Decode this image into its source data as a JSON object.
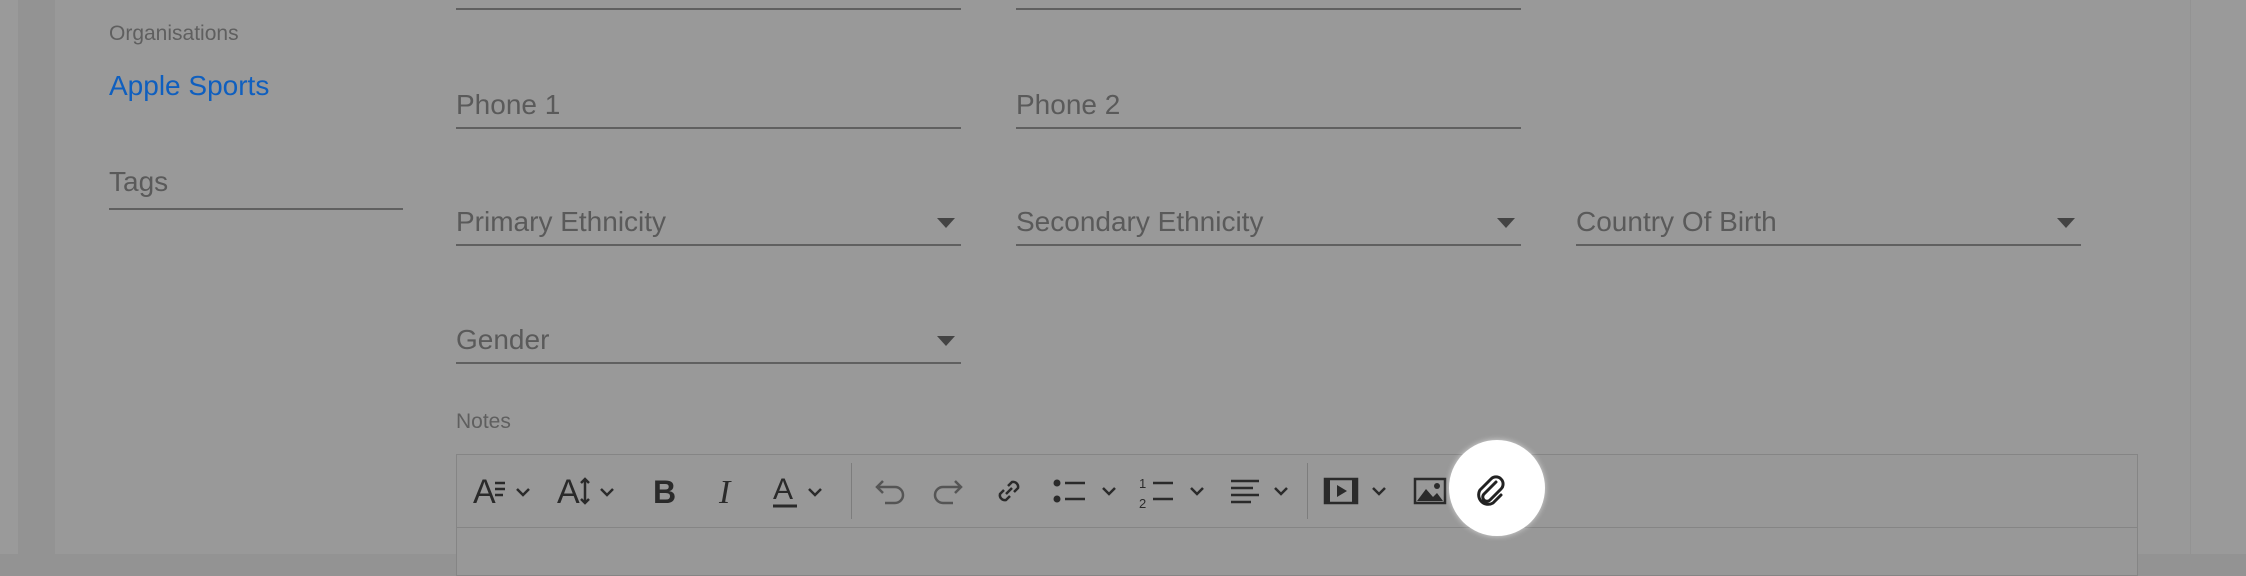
{
  "sidebar": {
    "organisations_label": "Organisations",
    "organisation": "Apple Sports",
    "tags_label": "Tags"
  },
  "form": {
    "phone1_label": "Phone 1",
    "phone2_label": "Phone 2",
    "primary_ethnicity_label": "Primary Ethnicity",
    "secondary_ethnicity_label": "Secondary Ethnicity",
    "country_of_birth_label": "Country Of Birth",
    "gender_label": "Gender",
    "notes_label": "Notes"
  },
  "toolbar": {
    "icons": [
      "paragraph-format-icon",
      "font-size-icon",
      "bold-icon",
      "italic-icon",
      "text-color-icon",
      "undo-icon",
      "redo-icon",
      "link-icon",
      "bullet-list-icon",
      "numbered-list-icon",
      "align-icon",
      "video-icon",
      "image-icon",
      "attachment-icon"
    ],
    "highlighted": "attachment-icon"
  },
  "colors": {
    "link": "#0f5fbf",
    "overlay_bg": "#999999",
    "spotlight": "#ffffff"
  }
}
